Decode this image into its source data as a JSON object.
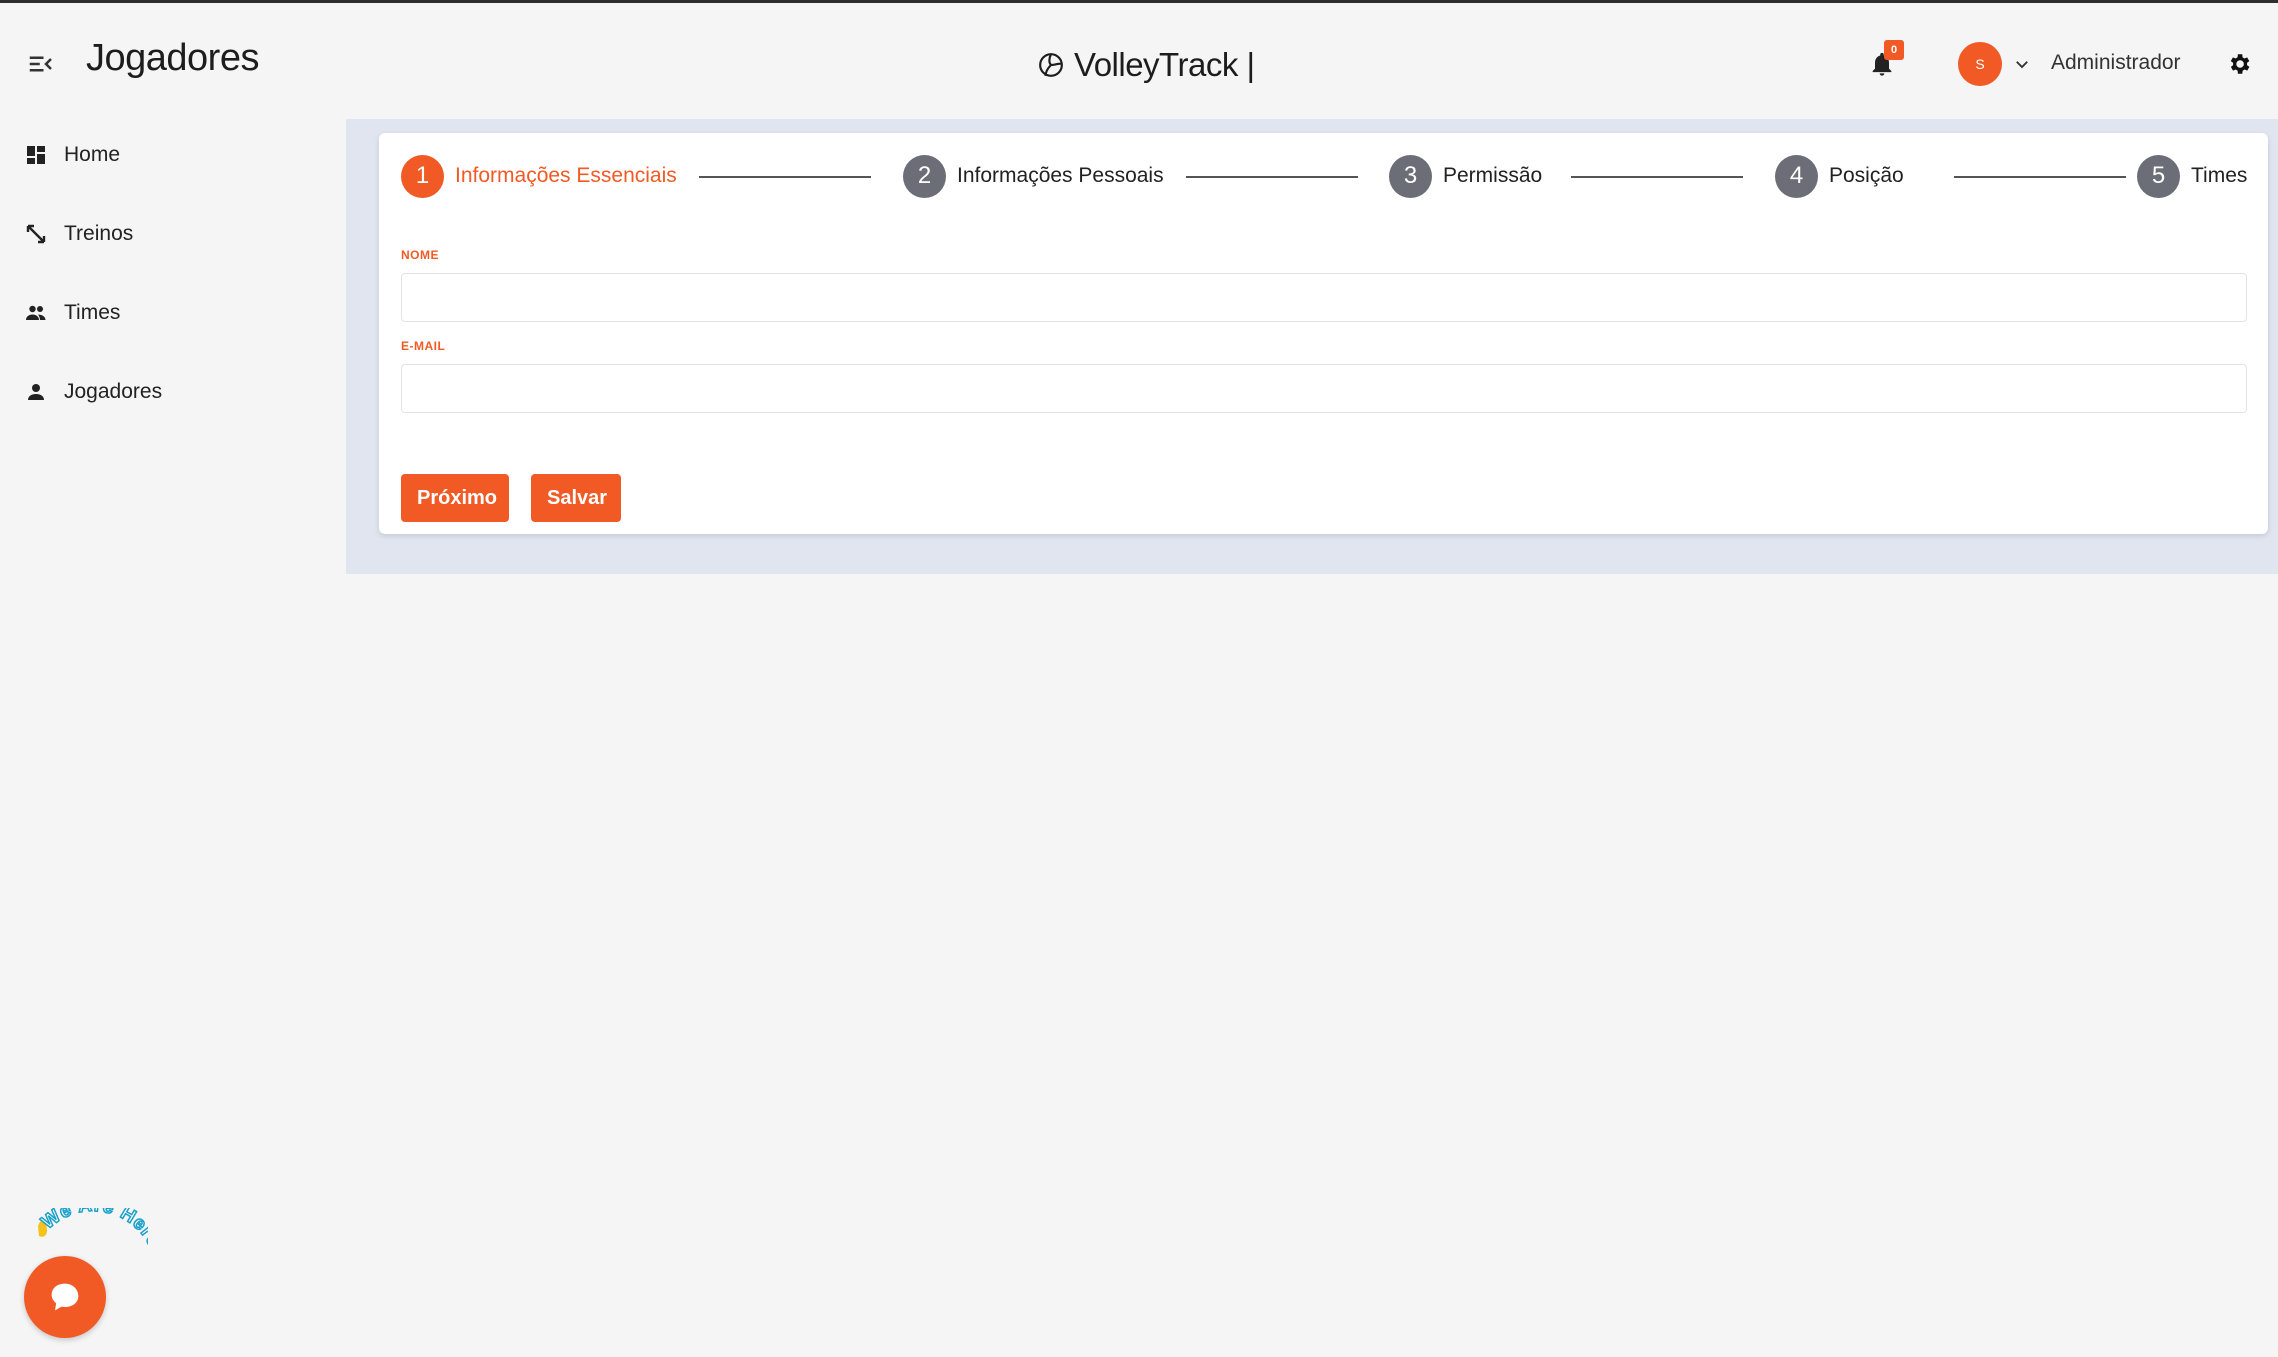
{
  "header": {
    "page_title": "Jogadores",
    "brand": "VolleyTrack |",
    "notification_count": "0",
    "avatar_initial": "S",
    "user_name": "Administrador"
  },
  "sidebar": {
    "items": [
      {
        "label": "Home",
        "icon": "dashboard-icon"
      },
      {
        "label": "Treinos",
        "icon": "arrows-diagonal-icon"
      },
      {
        "label": "Times",
        "icon": "group-icon"
      },
      {
        "label": "Jogadores",
        "icon": "person-icon"
      }
    ]
  },
  "stepper": {
    "steps": [
      {
        "number": "1",
        "label": "Informações Essenciais",
        "active": true
      },
      {
        "number": "2",
        "label": "Informações Pessoais",
        "active": false
      },
      {
        "number": "3",
        "label": "Permissão",
        "active": false
      },
      {
        "number": "4",
        "label": "Posição",
        "active": false
      },
      {
        "number": "5",
        "label": "Times",
        "active": false
      }
    ]
  },
  "form": {
    "nome_label": "NOME",
    "nome_value": "",
    "email_label": "E-MAIL",
    "email_value": "",
    "next_button": "Próximo",
    "save_button": "Salvar"
  },
  "chat": {
    "badge_text": "We Are Here!"
  },
  "colors": {
    "accent": "#f15a24",
    "step_inactive": "#6b6e76",
    "band_background": "#e1e5f0",
    "page_background": "#f5f5f5"
  }
}
